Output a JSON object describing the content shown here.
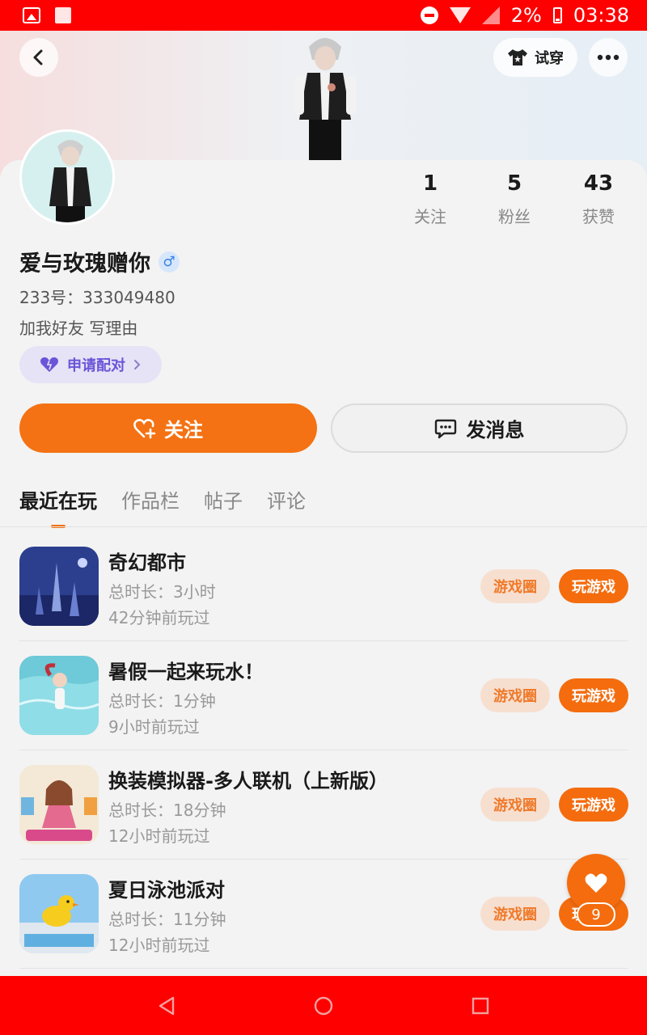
{
  "status_bar": {
    "battery": "2%",
    "time": "03:38"
  },
  "header": {
    "try_on_label": "试穿"
  },
  "profile": {
    "username": "爱与玫瑰赠你",
    "gender_symbol": "♂",
    "id_label": "233号：333049480",
    "bio": "加我好友 写理由",
    "pair_label": "申请配对"
  },
  "stats": [
    {
      "count": "1",
      "label": "关注"
    },
    {
      "count": "5",
      "label": "粉丝"
    },
    {
      "count": "43",
      "label": "获赞"
    }
  ],
  "actions": {
    "follow_label": "关注",
    "message_label": "发消息"
  },
  "tabs": [
    {
      "label": "最近在玩",
      "active": true
    },
    {
      "label": "作品栏",
      "active": false
    },
    {
      "label": "帖子",
      "active": false
    },
    {
      "label": "评论",
      "active": false
    }
  ],
  "game_buttons": {
    "circle_label": "游戏圈",
    "play_label": "玩游戏"
  },
  "games": [
    {
      "title": "奇幻都市",
      "duration": "总时长：3小时",
      "last_played": "42分钟前玩过"
    },
    {
      "title": "暑假一起来玩水！",
      "duration": "总时长：1分钟",
      "last_played": "9小时前玩过"
    },
    {
      "title": "换装模拟器-多人联机（上新版）",
      "duration": "总时长：18分钟",
      "last_played": "12小时前玩过"
    },
    {
      "title": "夏日泳池派对",
      "duration": "总时长：11分钟",
      "last_played": "12小时前玩过"
    }
  ],
  "like_count": "9",
  "colors": {
    "accent": "#f46c0e",
    "status_bar": "#ff0000",
    "pair_text": "#6a55d8"
  }
}
